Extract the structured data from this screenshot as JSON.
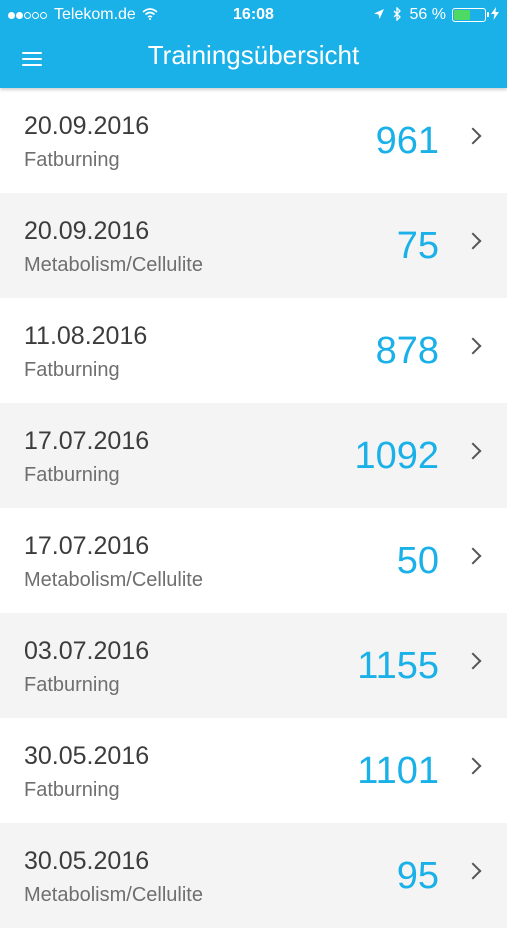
{
  "status_bar": {
    "carrier": "Telekom.de",
    "time": "16:08",
    "battery_pct": "56 %",
    "battery_level": 0.56,
    "signal_bars_filled": 2,
    "signal_bars_total": 5
  },
  "header": {
    "title": "Trainingsübersicht",
    "menu_icon": "hamburger-menu-icon"
  },
  "accent_color": "#1ab0e8",
  "trainings": [
    {
      "date": "20.09.2016",
      "type": "Fatburning",
      "value": "961"
    },
    {
      "date": "20.09.2016",
      "type": "Metabolism/Cellulite",
      "value": "75"
    },
    {
      "date": "11.08.2016",
      "type": "Fatburning",
      "value": "878"
    },
    {
      "date": "17.07.2016",
      "type": "Fatburning",
      "value": "1092"
    },
    {
      "date": "17.07.2016",
      "type": "Metabolism/Cellulite",
      "value": "50"
    },
    {
      "date": "03.07.2016",
      "type": "Fatburning",
      "value": "1155"
    },
    {
      "date": "30.05.2016",
      "type": "Fatburning",
      "value": "1101"
    },
    {
      "date": "30.05.2016",
      "type": "Metabolism/Cellulite",
      "value": "95"
    }
  ]
}
